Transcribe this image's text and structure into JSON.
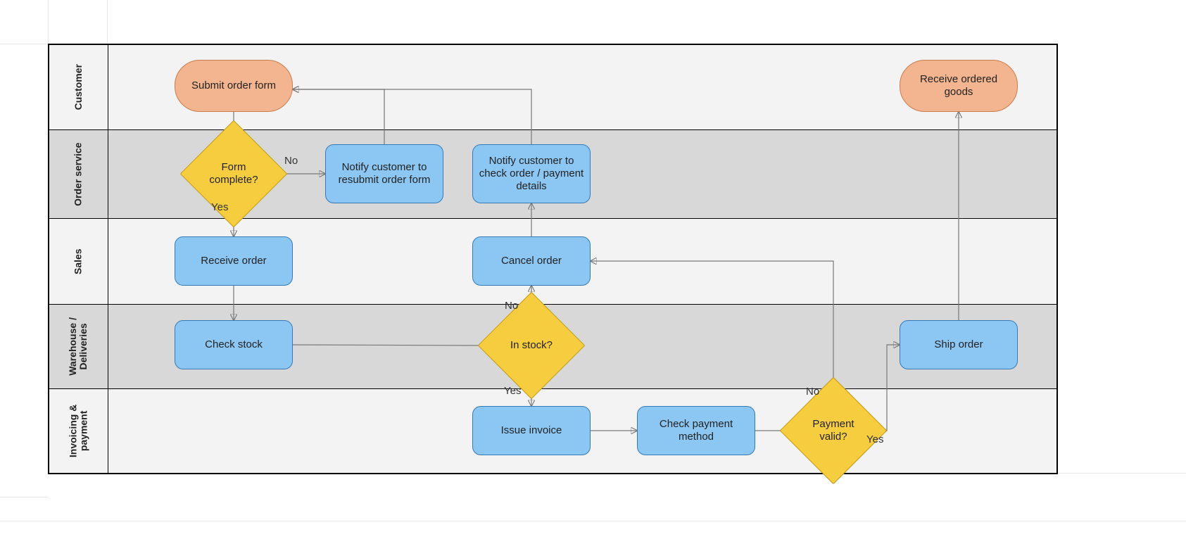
{
  "lanes": {
    "customer": "Customer",
    "order_service": "Order service",
    "sales": "Sales",
    "warehouse": "Warehouse /\nDeliveries",
    "invoicing": "Invoicing &\npayment"
  },
  "nodes": {
    "submit_order": "Submit order form",
    "receive_goods": "Receive ordered goods",
    "form_complete": "Form complete?",
    "notify_resubmit": "Notify customer to resubmit order form",
    "notify_check": "Notify customer to check order / payment details",
    "receive_order": "Receive order",
    "cancel_order": "Cancel order",
    "check_stock": "Check stock",
    "in_stock": "In stock?",
    "ship_order": "Ship order",
    "issue_invoice": "Issue invoice",
    "check_payment_method": "Check payment method",
    "payment_valid": "Payment valid?"
  },
  "edge_labels": {
    "no": "No",
    "yes": "Yes"
  },
  "colors": {
    "terminator_fill": "#f3b58f",
    "terminator_stroke": "#c87c4d",
    "process_fill": "#8cc7f4",
    "process_stroke": "#357ab7",
    "decision_fill": "#f6cd3f",
    "decision_stroke": "#c49a12",
    "lane_light": "#f3f3f3",
    "lane_dark": "#d8d8d8",
    "connector": "#777777"
  },
  "chart_data": {
    "type": "flowchart-swimlane",
    "lanes": [
      "Customer",
      "Order service",
      "Sales",
      "Warehouse / Deliveries",
      "Invoicing & payment"
    ],
    "nodes": [
      {
        "id": "submit_order",
        "lane": "Customer",
        "type": "terminator",
        "label": "Submit order form"
      },
      {
        "id": "receive_goods",
        "lane": "Customer",
        "type": "terminator",
        "label": "Receive ordered goods"
      },
      {
        "id": "form_complete",
        "lane": "Order service",
        "type": "decision",
        "label": "Form complete?"
      },
      {
        "id": "notify_resubmit",
        "lane": "Order service",
        "type": "process",
        "label": "Notify customer to resubmit order form"
      },
      {
        "id": "notify_check",
        "lane": "Order service",
        "type": "process",
        "label": "Notify customer to check order / payment details"
      },
      {
        "id": "receive_order",
        "lane": "Sales",
        "type": "process",
        "label": "Receive order"
      },
      {
        "id": "cancel_order",
        "lane": "Sales",
        "type": "process",
        "label": "Cancel order"
      },
      {
        "id": "check_stock",
        "lane": "Warehouse / Deliveries",
        "type": "process",
        "label": "Check stock"
      },
      {
        "id": "in_stock",
        "lane": "Warehouse / Deliveries",
        "type": "decision",
        "label": "In stock?"
      },
      {
        "id": "ship_order",
        "lane": "Warehouse / Deliveries",
        "type": "process",
        "label": "Ship order"
      },
      {
        "id": "issue_invoice",
        "lane": "Invoicing & payment",
        "type": "process",
        "label": "Issue invoice"
      },
      {
        "id": "check_payment_method",
        "lane": "Invoicing & payment",
        "type": "process",
        "label": "Check payment method"
      },
      {
        "id": "payment_valid",
        "lane": "Invoicing & payment",
        "type": "decision",
        "label": "Payment valid?"
      }
    ],
    "edges": [
      {
        "from": "submit_order",
        "to": "form_complete"
      },
      {
        "from": "form_complete",
        "to": "notify_resubmit",
        "label": "No"
      },
      {
        "from": "form_complete",
        "to": "receive_order",
        "label": "Yes"
      },
      {
        "from": "notify_resubmit",
        "to": "submit_order"
      },
      {
        "from": "receive_order",
        "to": "check_stock"
      },
      {
        "from": "check_stock",
        "to": "in_stock"
      },
      {
        "from": "in_stock",
        "to": "cancel_order",
        "label": "No"
      },
      {
        "from": "in_stock",
        "to": "issue_invoice",
        "label": "Yes"
      },
      {
        "from": "cancel_order",
        "to": "notify_check"
      },
      {
        "from": "notify_check",
        "to": "submit_order"
      },
      {
        "from": "issue_invoice",
        "to": "check_payment_method"
      },
      {
        "from": "check_payment_method",
        "to": "payment_valid"
      },
      {
        "from": "payment_valid",
        "to": "cancel_order",
        "label": "No"
      },
      {
        "from": "payment_valid",
        "to": "ship_order",
        "label": "Yes"
      },
      {
        "from": "ship_order",
        "to": "receive_goods"
      }
    ]
  }
}
